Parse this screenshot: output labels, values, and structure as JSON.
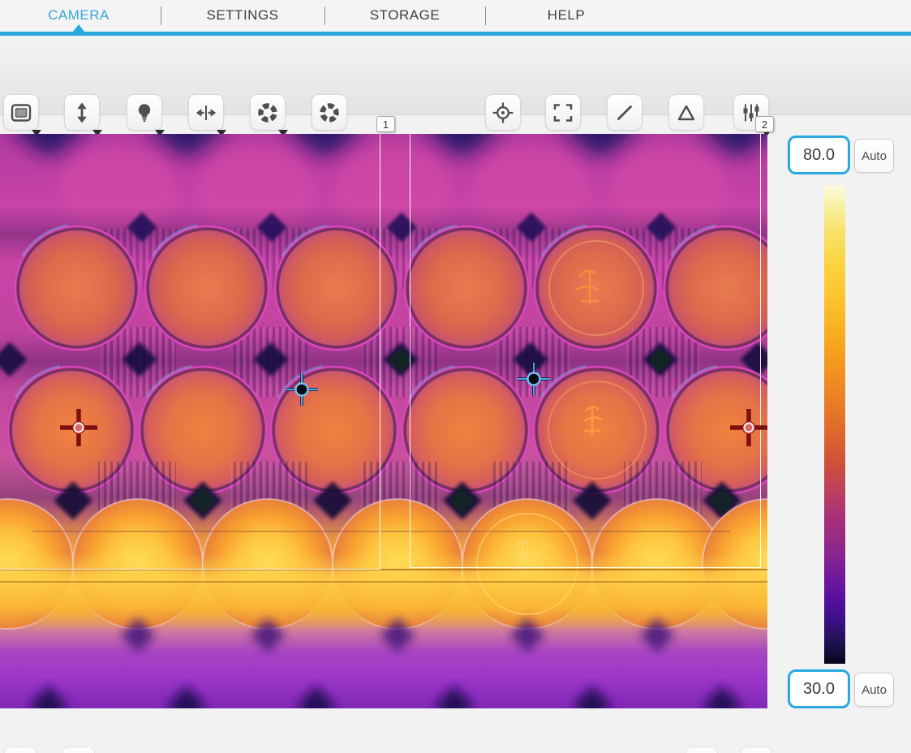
{
  "nav": {
    "items": [
      {
        "label": "CAMERA",
        "active": true
      },
      {
        "label": "SETTINGS",
        "active": false
      },
      {
        "label": "STORAGE",
        "active": false
      },
      {
        "label": "HELP",
        "active": false
      }
    ]
  },
  "toolbar": {
    "left_buttons": [
      {
        "icon": "display-mode-icon",
        "has_dropdown": true
      },
      {
        "icon": "vertical-arrows-icon",
        "has_dropdown": true
      },
      {
        "icon": "bulb-icon",
        "has_dropdown": true
      },
      {
        "icon": "horizontal-split-arrows-icon",
        "has_dropdown": true
      },
      {
        "icon": "shutter-icon",
        "has_dropdown": true
      },
      {
        "icon": "shutter-calibrate-icon",
        "has_dropdown": false
      }
    ],
    "right_buttons": [
      {
        "icon": "spot-meter-icon",
        "has_dropdown": false
      },
      {
        "icon": "area-meter-icon",
        "has_dropdown": false
      },
      {
        "icon": "line-meter-icon",
        "has_dropdown": false
      },
      {
        "icon": "delta-meter-icon",
        "has_dropdown": false
      },
      {
        "icon": "adjustments-icon",
        "has_dropdown": true
      }
    ]
  },
  "scale": {
    "max_value": "80.0",
    "min_value": "30.0",
    "auto_label": "Auto",
    "palette_top_color": "#fcfbe0",
    "palette_bottom_color": "#070418",
    "accent_blue": "#2aa9df"
  },
  "overlays": {
    "regions": [
      {
        "label": "1"
      },
      {
        "label": "2"
      }
    ],
    "markers": [
      {
        "type": "hot-spot",
        "color": "#7d1010"
      },
      {
        "type": "hot-spot",
        "color": "#7d1010"
      },
      {
        "type": "cold-spot",
        "color": "#4aa7e8"
      },
      {
        "type": "cold-spot",
        "color": "#4aa7e8"
      }
    ]
  }
}
